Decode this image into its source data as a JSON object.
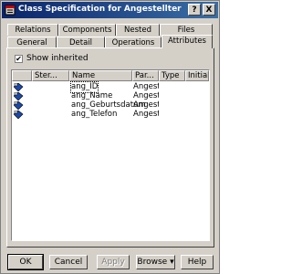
{
  "window": {
    "title": "Class Specification for Angestellter",
    "help_glyph": "?",
    "close_glyph": "X"
  },
  "tabs": {
    "row_back": [
      "Relations",
      "Components",
      "Nested",
      "Files"
    ],
    "row_front": [
      "General",
      "Detail",
      "Operations",
      "Attributes"
    ],
    "active": "Attributes"
  },
  "show_inherited": {
    "label": "Show inherited",
    "checked": true,
    "mark": "✔"
  },
  "attributes_table": {
    "columns": [
      "",
      "Ster...",
      "Name",
      "Par...",
      "Type",
      "Initial"
    ],
    "rows": [
      {
        "stereotype": "",
        "name": "ang_ID",
        "parent": "Angeste",
        "type": "",
        "initial": ""
      },
      {
        "stereotype": "",
        "name": "ang_Name",
        "parent": "Angeste",
        "type": "",
        "initial": ""
      },
      {
        "stereotype": "",
        "name": "ang_Geburtsdatum",
        "parent": "Angeste",
        "type": "",
        "initial": ""
      },
      {
        "stereotype": "",
        "name": "ang_Telefon",
        "parent": "Angeste",
        "type": "",
        "initial": ""
      }
    ]
  },
  "buttons": {
    "ok": "OK",
    "cancel": "Cancel",
    "apply": "Apply",
    "browse": "Browse",
    "browse_arrow": "▾",
    "help": "Help"
  },
  "colors": {
    "title_bar_start": "#0a246a",
    "title_bar_end": "#3a6ea5",
    "face": "#d4d0c8",
    "attribute_icon": "#1c49a8"
  }
}
